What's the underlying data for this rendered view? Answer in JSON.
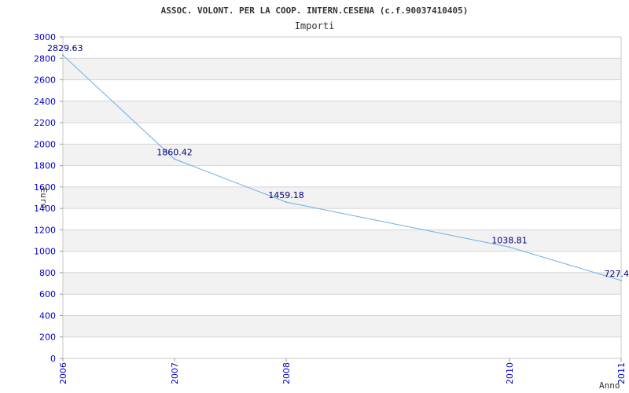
{
  "chart_data": {
    "type": "line",
    "title": "ASSOC. VOLONT. PER LA COOP. INTERN.CESENA (c.f.90037410405)",
    "subtitle": "Importi",
    "xlabel": "Anno",
    "ylabel": "Euro",
    "x": [
      "2006",
      "2007",
      "2008",
      "2010",
      "2011"
    ],
    "x_numeric": [
      2006,
      2007,
      2008,
      2010,
      2011
    ],
    "xlim": [
      2006,
      2011
    ],
    "ylim": [
      0,
      3000
    ],
    "y_ticks": [
      0,
      200,
      400,
      600,
      800,
      1000,
      1200,
      1400,
      1600,
      1800,
      2000,
      2200,
      2400,
      2600,
      2800,
      3000
    ],
    "series": [
      {
        "values": [
          2829.63,
          1860.42,
          1459.18,
          1038.81,
          727.4
        ],
        "labels": [
          "2829.63",
          "1860.42",
          "1459.18",
          "1038.81",
          "727.4"
        ],
        "color": "#6aaee8"
      }
    ],
    "grid": true,
    "band_color": "#f2f2f2",
    "grid_color": "#d4d4d4",
    "tick_label_color": "#0000cc",
    "data_label_color": "#000080",
    "legend": "none"
  }
}
